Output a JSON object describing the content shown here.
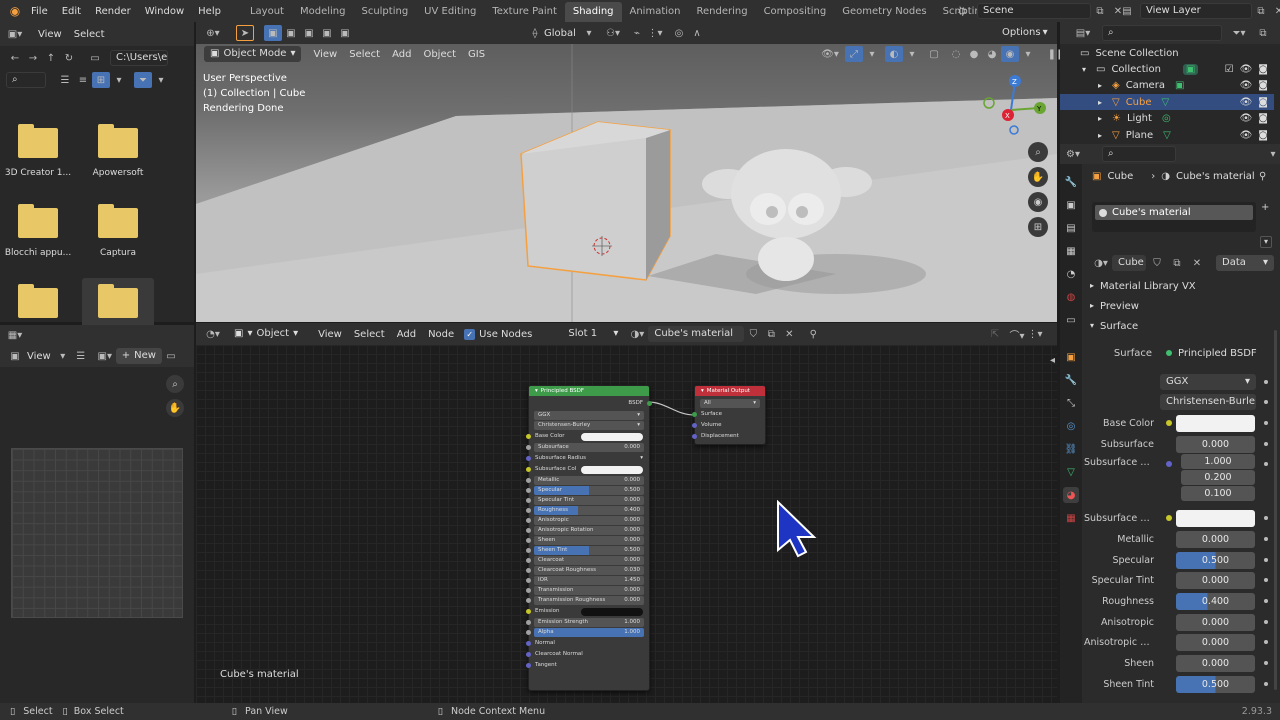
{
  "menu": {
    "items": [
      "File",
      "Edit",
      "Render",
      "Window",
      "Help"
    ]
  },
  "workspaces": {
    "tabs": [
      "Layout",
      "Modeling",
      "Sculpting",
      "UV Editing",
      "Texture Paint",
      "Shading",
      "Animation",
      "Rendering",
      "Compositing",
      "Geometry Nodes",
      "Scripting"
    ],
    "active": "Shading",
    "add": "+"
  },
  "scene": {
    "name": "Scene"
  },
  "view_layer": {
    "name": "View Layer"
  },
  "file_browser": {
    "header": {
      "view": "View",
      "select": "Select"
    },
    "path": "C:\\Users\\e...",
    "folders": [
      "3D Creator 1...",
      "Apowersoft",
      "Blocchi appu...",
      "Captura",
      "",
      ""
    ]
  },
  "image_editor": {
    "view": "View",
    "new": "New"
  },
  "viewport": {
    "mode": "Object Mode",
    "menus": [
      "View",
      "Select",
      "Add",
      "Object",
      "GIS"
    ],
    "transform": "Global",
    "options": "Options",
    "overlay_lines": [
      "User Perspective",
      "(1) Collection | Cube",
      "Rendering Done"
    ],
    "gizmo": {
      "x": "X",
      "y": "Y",
      "z": "Z"
    }
  },
  "node_editor": {
    "type": "Object",
    "menus": [
      "View",
      "Select",
      "Add",
      "Node"
    ],
    "use_nodes": "Use Nodes",
    "slot": "Slot 1",
    "material": "Cube's material",
    "footer_label": "Cube's material",
    "principled": {
      "title": "Principled BSDF",
      "output": "BSDF",
      "dist": "GGX",
      "sss": "Christensen-Burley",
      "rows": [
        {
          "label": "Base Color",
          "value": "",
          "type": "color",
          "sock": "y"
        },
        {
          "label": "Subsurface",
          "value": "0.000",
          "type": "field",
          "sock": "g"
        },
        {
          "label": "Subsurface Radius",
          "value": "",
          "type": "dd",
          "sock": "p"
        },
        {
          "label": "Subsurface Col",
          "value": "",
          "type": "color",
          "sock": "y"
        },
        {
          "label": "Metallic",
          "value": "0.000",
          "type": "field",
          "sock": "g"
        },
        {
          "label": "Specular",
          "value": "0.500",
          "type": "blue",
          "sock": "g",
          "frac": 0.5
        },
        {
          "label": "Specular Tint",
          "value": "0.000",
          "type": "field",
          "sock": "g"
        },
        {
          "label": "Roughness",
          "value": "0.400",
          "type": "blue",
          "sock": "g",
          "frac": 0.4
        },
        {
          "label": "Anisotropic",
          "value": "0.000",
          "type": "field",
          "sock": "g"
        },
        {
          "label": "Anisotropic Rotation",
          "value": "0.000",
          "type": "field",
          "sock": "g"
        },
        {
          "label": "Sheen",
          "value": "0.000",
          "type": "field",
          "sock": "g"
        },
        {
          "label": "Sheen Tint",
          "value": "0.500",
          "type": "blue",
          "sock": "g",
          "frac": 0.5
        },
        {
          "label": "Clearcoat",
          "value": "0.000",
          "type": "field",
          "sock": "g"
        },
        {
          "label": "Clearcoat Roughness",
          "value": "0.030",
          "type": "field",
          "sock": "g"
        },
        {
          "label": "IOR",
          "value": "1.450",
          "type": "field",
          "sock": "g"
        },
        {
          "label": "Transmission",
          "value": "0.000",
          "type": "field",
          "sock": "g"
        },
        {
          "label": "Transmission Roughness",
          "value": "0.000",
          "type": "field",
          "sock": "g"
        },
        {
          "label": "Emission",
          "value": "",
          "type": "dark",
          "sock": "y"
        },
        {
          "label": "Emission Strength",
          "value": "1.000",
          "type": "field",
          "sock": "g"
        },
        {
          "label": "Alpha",
          "value": "1.000",
          "type": "blue",
          "sock": "g",
          "frac": 1.0
        },
        {
          "label": "Normal",
          "value": "",
          "type": "label",
          "sock": "p"
        },
        {
          "label": "Clearcoat Normal",
          "value": "",
          "type": "label",
          "sock": "p"
        },
        {
          "label": "Tangent",
          "value": "",
          "type": "label",
          "sock": "p"
        }
      ]
    },
    "output": {
      "title": "Material Output",
      "target": "All",
      "inputs": [
        "Surface",
        "Volume",
        "Displacement"
      ]
    }
  },
  "outliner": {
    "root": "Scene Collection",
    "items": [
      {
        "name": "Collection",
        "indent": 0,
        "selected": false
      },
      {
        "name": "Camera",
        "indent": 1,
        "selected": false
      },
      {
        "name": "Cube",
        "indent": 1,
        "selected": true
      },
      {
        "name": "Light",
        "indent": 1,
        "selected": false
      },
      {
        "name": "Plane",
        "indent": 1,
        "selected": false
      }
    ]
  },
  "properties": {
    "breadcrumb_object": "Cube",
    "breadcrumb_material": "Cube's material",
    "slot_name": "Cube's material",
    "material_field": "Cube...",
    "link": "Data",
    "panels": [
      "Material Library VX",
      "Preview",
      "Surface"
    ],
    "surface_label": "Surface",
    "surface_value": "Principled BSDF",
    "dist": "GGX",
    "sss": "Christensen-Burle",
    "rows": [
      {
        "label": "Base Color",
        "value": "",
        "type": "color",
        "dot": "#c7c729"
      },
      {
        "label": "Subsurface",
        "value": "0.000",
        "type": "field"
      },
      {
        "label": "Subsurface R...",
        "value": "1.000",
        "type": "field",
        "dot": "#6363c7"
      },
      {
        "label": "",
        "value": "0.200",
        "type": "field"
      },
      {
        "label": "",
        "value": "0.100",
        "type": "field"
      },
      {
        "label": "Subsurface C...",
        "value": "",
        "type": "color",
        "dot": "#c7c729"
      },
      {
        "label": "Metallic",
        "value": "0.000",
        "type": "field"
      },
      {
        "label": "Specular",
        "value": "0.500",
        "type": "blue",
        "frac": 0.5
      },
      {
        "label": "Specular Tint",
        "value": "0.000",
        "type": "field"
      },
      {
        "label": "Roughness",
        "value": "0.400",
        "type": "blue",
        "frac": 0.4
      },
      {
        "label": "Anisotropic",
        "value": "0.000",
        "type": "field"
      },
      {
        "label": "Anisotropic R...",
        "value": "0.000",
        "type": "field"
      },
      {
        "label": "Sheen",
        "value": "0.000",
        "type": "field"
      },
      {
        "label": "Sheen Tint",
        "value": "0.500",
        "type": "blue",
        "frac": 0.5
      }
    ]
  },
  "statusbar": {
    "select": "Select",
    "box_select": "Box Select",
    "pan": "Pan View",
    "context": "Node Context Menu",
    "version": "2.93.3"
  },
  "colors": {
    "accent": "#4772b3",
    "selected_orange": "#f5a040",
    "node_green": "#3d9b4a",
    "node_red": "#c0303a"
  }
}
